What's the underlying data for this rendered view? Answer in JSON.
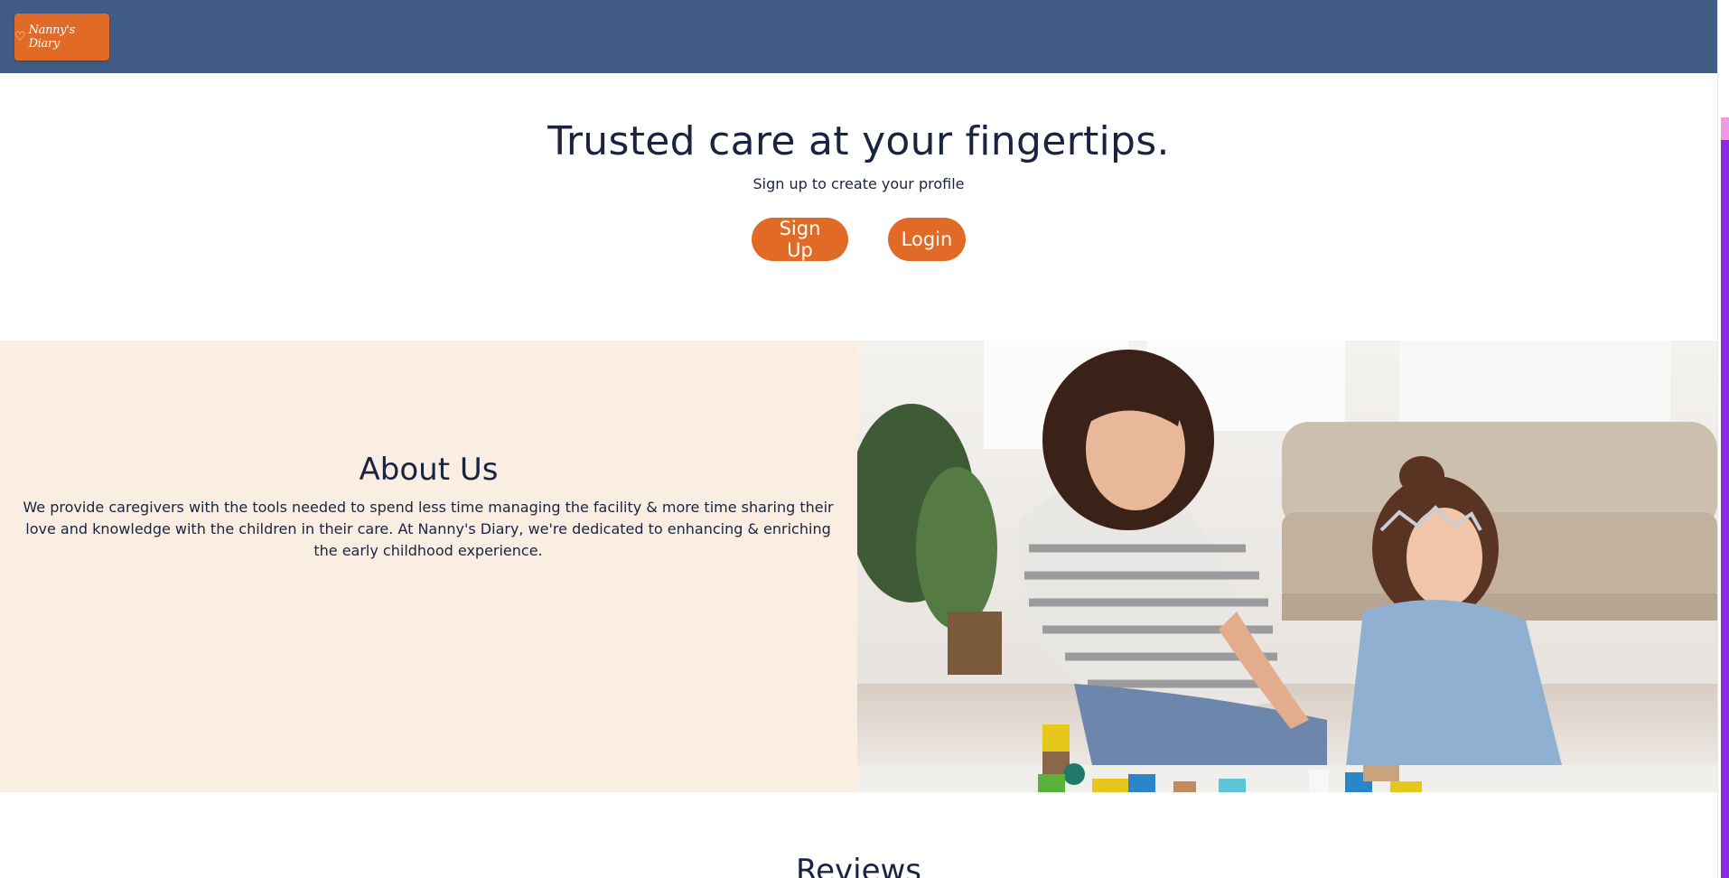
{
  "header": {
    "logo_text": "Nanny's Diary",
    "logo_icon": "heart-icon",
    "background_color": "#405c84"
  },
  "hero": {
    "title": "Trusted care at your fingertips.",
    "subtitle": "Sign up to create your profile",
    "signup_label": "Sign Up",
    "login_label": "Login",
    "button_color": "#e16b26"
  },
  "about": {
    "title": "About Us",
    "text": "We provide caregivers with the tools needed to spend less time managing the facility & more time sharing their love and knowledge with the children in their care. At Nanny's Diary, we're dedicated to enhancing & enriching the early childhood experience.",
    "background_color": "#faede1"
  },
  "reviews": {
    "title": "Reviews"
  }
}
